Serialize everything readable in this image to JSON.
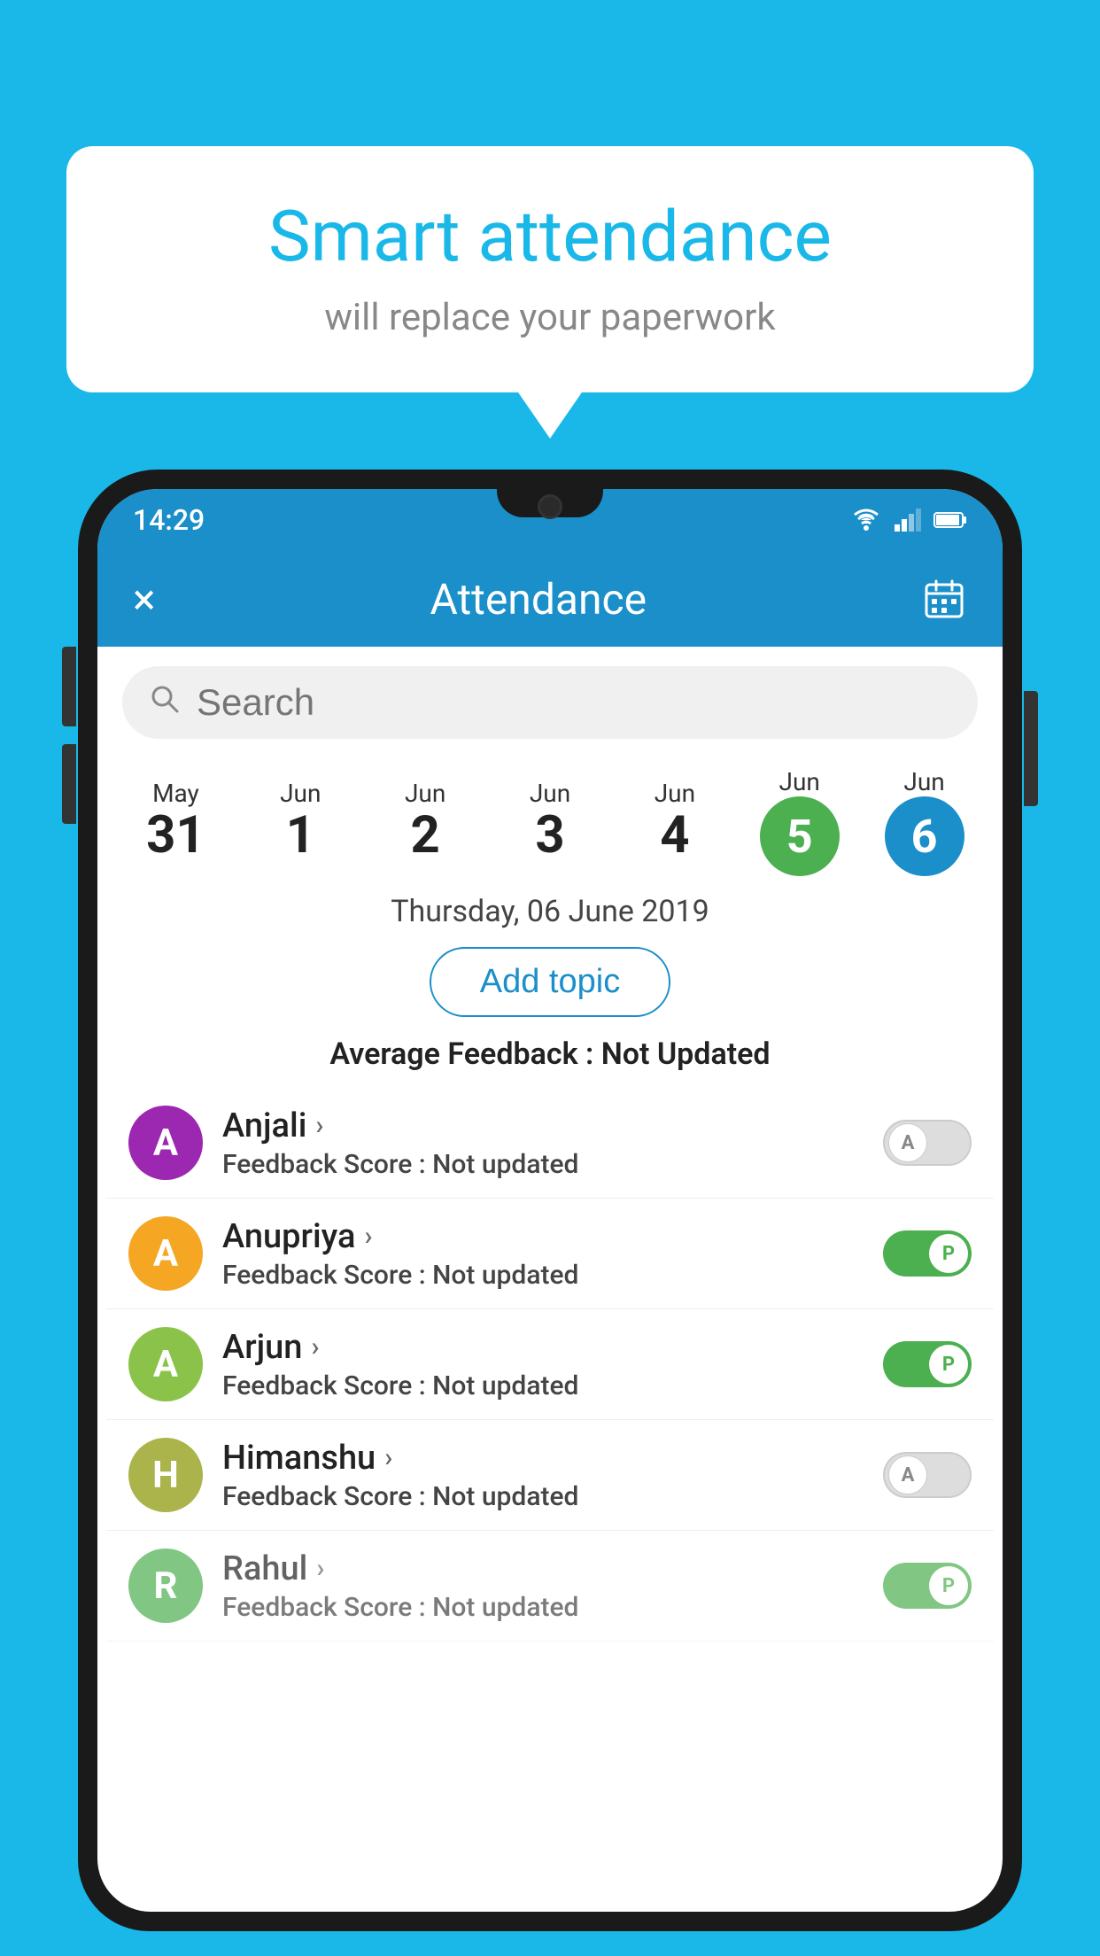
{
  "background": {
    "color": "#1ab8e8"
  },
  "speech_bubble": {
    "title": "Smart attendance",
    "subtitle": "will replace your paperwork"
  },
  "status_bar": {
    "time": "14:29"
  },
  "app_bar": {
    "title": "Attendance",
    "close_label": "×"
  },
  "search": {
    "placeholder": "Search"
  },
  "dates": [
    {
      "month": "May",
      "day": "31",
      "active": ""
    },
    {
      "month": "Jun",
      "day": "1",
      "active": ""
    },
    {
      "month": "Jun",
      "day": "2",
      "active": ""
    },
    {
      "month": "Jun",
      "day": "3",
      "active": ""
    },
    {
      "month": "Jun",
      "day": "4",
      "active": ""
    },
    {
      "month": "Jun",
      "day": "5",
      "active": "green"
    },
    {
      "month": "Jun",
      "day": "6",
      "active": "blue"
    }
  ],
  "selected_date": "Thursday, 06 June 2019",
  "add_topic_label": "Add topic",
  "average_feedback_label": "Average Feedback :",
  "average_feedback_value": "Not Updated",
  "students": [
    {
      "name": "Anjali",
      "initial": "A",
      "avatar_color": "#9c27b0",
      "feedback_label": "Feedback Score :",
      "feedback_value": "Not updated",
      "toggle": "off"
    },
    {
      "name": "Anupriya",
      "initial": "A",
      "avatar_color": "#f5a623",
      "feedback_label": "Feedback Score :",
      "feedback_value": "Not updated",
      "toggle": "on"
    },
    {
      "name": "Arjun",
      "initial": "A",
      "avatar_color": "#8bc34a",
      "feedback_label": "Feedback Score :",
      "feedback_value": "Not updated",
      "toggle": "on"
    },
    {
      "name": "Himanshu",
      "initial": "H",
      "avatar_color": "#aab44a",
      "feedback_label": "Feedback Score :",
      "feedback_value": "Not updated",
      "toggle": "off"
    },
    {
      "name": "Rahul",
      "initial": "R",
      "avatar_color": "#4caf50",
      "feedback_label": "Feedback Score :",
      "feedback_value": "Not updated",
      "toggle": "on"
    }
  ]
}
